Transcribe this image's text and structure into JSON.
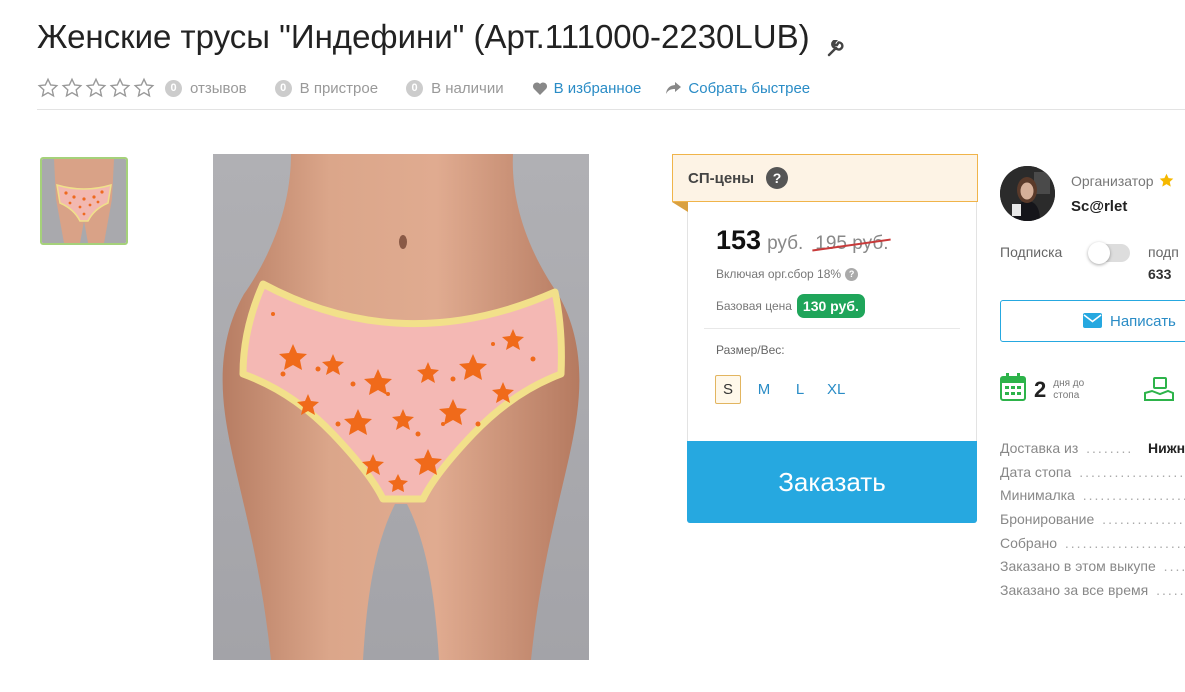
{
  "product": {
    "title": "Женские трусы \"Индефини\" (Арт.111000-2230LUB)"
  },
  "meta": {
    "reviews_count": "0",
    "reviews_label": "отзывов",
    "attach_count": "0",
    "attach_label": "В пристрое",
    "stock_count": "0",
    "stock_label": "В наличии",
    "favorite_label": "В избранное",
    "collect_label": "Собрать быстрее",
    "rating": 0,
    "rating_max": 5
  },
  "pricing": {
    "header": "СП-цены",
    "help": "?",
    "price": "153",
    "currency": "руб.",
    "old_price": "195 руб.",
    "fee_text": "Включая орг.сбор 18%",
    "fee_help": "?",
    "base_label": "Базовая цена",
    "base_value": "130 руб.",
    "size_label": "Размер/Вес:",
    "sizes": [
      "S",
      "M",
      "L",
      "XL"
    ],
    "selected_size": "S",
    "order_label": "Заказать"
  },
  "organizer": {
    "label": "Организатор",
    "name": "Sc@rlet",
    "subscription_label": "Подписка",
    "subscription_extra": "подп",
    "subscribers": "633",
    "write_label": "Написать",
    "days_value": "2",
    "days_text_1": "дня до",
    "days_text_2": "стопа",
    "info_rows": [
      {
        "label": "Доставка из",
        "dots": " ........",
        "value": "Нижн"
      },
      {
        "label": "Дата стопа",
        "dots": " ..............................",
        "value": ""
      },
      {
        "label": "Минималка",
        "dots": " ..............................",
        "value": ""
      },
      {
        "label": "Бронирование",
        "dots": " ..............................",
        "value": ""
      },
      {
        "label": "Собрано",
        "dots": " ..............................",
        "value": ""
      },
      {
        "label": "Заказано в этом выкупе",
        "dots": " ........",
        "value": ""
      },
      {
        "label": "Заказано за все время",
        "dots": " ........",
        "value": ""
      }
    ]
  },
  "colors": {
    "accent": "#26a8e0",
    "link": "#2a8cc6",
    "green_badge": "#1fa55a",
    "sp_header_bg": "#fdf3e5",
    "sp_header_border": "#f0b44a",
    "calendar_green": "#2db34a",
    "star_gold": "#f5b800"
  }
}
